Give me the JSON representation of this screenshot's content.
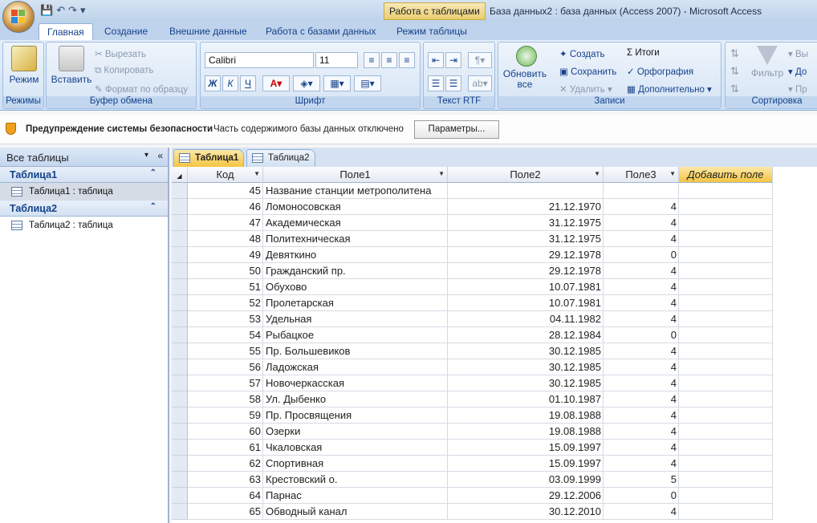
{
  "app": {
    "context_tab": "Работа с таблицами",
    "window_title": "База данных2 : база данных (Access 2007) - Microsoft Access"
  },
  "tabs": [
    "Главная",
    "Создание",
    "Внешние данные",
    "Работа с базами данных",
    "Режим таблицы"
  ],
  "ribbon": {
    "modes": {
      "btn": "Режим",
      "label": "Режимы"
    },
    "clipboard": {
      "paste": "Вставить",
      "cut": "Вырезать",
      "copy": "Копировать",
      "format": "Формат по образцу",
      "label": "Буфер обмена"
    },
    "font": {
      "name": "Calibri",
      "size": "11",
      "bold": "Ж",
      "italic": "К",
      "underline": "Ч",
      "label": "Шрифт"
    },
    "rtf": {
      "label": "Текст RTF"
    },
    "records": {
      "refresh": "Обновить все",
      "create": "Создать",
      "save": "Сохранить",
      "delete": "Удалить",
      "totals": "Итоги",
      "spelling": "Орфография",
      "more": "Дополнительно",
      "label": "Записи"
    },
    "sort": {
      "filter": "Фильтр",
      "label": "Сортировка",
      "v1": "Вы",
      "v2": "До",
      "v3": "Пр"
    }
  },
  "security": {
    "title": "Предупреждение системы безопасности",
    "text": "Часть содержимого базы данных отключено",
    "button": "Параметры..."
  },
  "nav": {
    "header": "Все таблицы",
    "groups": [
      {
        "name": "Таблица1",
        "item": "Таблица1 : таблица"
      },
      {
        "name": "Таблица2",
        "item": "Таблица2 : таблица"
      }
    ]
  },
  "doc_tabs": [
    "Таблица1",
    "Таблица2"
  ],
  "table": {
    "columns": [
      "Код",
      "Поле1",
      "Поле2",
      "Поле3",
      "Добавить поле"
    ],
    "rows": [
      [
        "45",
        "Название станции метрополитена",
        "",
        ""
      ],
      [
        "46",
        "Ломоносовская",
        "21.12.1970",
        "4"
      ],
      [
        "47",
        "Академическая",
        "31.12.1975",
        "4"
      ],
      [
        "48",
        "Политехническая",
        "31.12.1975",
        "4"
      ],
      [
        "49",
        "Девяткино",
        "29.12.1978",
        "0"
      ],
      [
        "50",
        "Гражданский пр.",
        "29.12.1978",
        "4"
      ],
      [
        "51",
        "Обухово",
        "10.07.1981",
        "4"
      ],
      [
        "52",
        "Пролетарская",
        "10.07.1981",
        "4"
      ],
      [
        "53",
        "Удельная",
        "04.11.1982",
        "4"
      ],
      [
        "54",
        "Рыбацкое",
        "28.12.1984",
        "0"
      ],
      [
        "55",
        "Пр. Большевиков",
        "30.12.1985",
        "4"
      ],
      [
        "56",
        "Ладожская",
        "30.12.1985",
        "4"
      ],
      [
        "57",
        "Новочеркасская",
        "30.12.1985",
        "4"
      ],
      [
        "58",
        "Ул. Дыбенко",
        "01.10.1987",
        "4"
      ],
      [
        "59",
        "Пр. Просвящения",
        "19.08.1988",
        "4"
      ],
      [
        "60",
        "Озерки",
        "19.08.1988",
        "4"
      ],
      [
        "61",
        "Чкаловская",
        "15.09.1997",
        "4"
      ],
      [
        "62",
        "Спортивная",
        "15.09.1997",
        "4"
      ],
      [
        "63",
        "Крестовский о.",
        "03.09.1999",
        "5"
      ],
      [
        "64",
        "Парнас",
        "29.12.2006",
        "0"
      ],
      [
        "65",
        "Обводный канал",
        "30.12.2010",
        "4"
      ]
    ]
  }
}
